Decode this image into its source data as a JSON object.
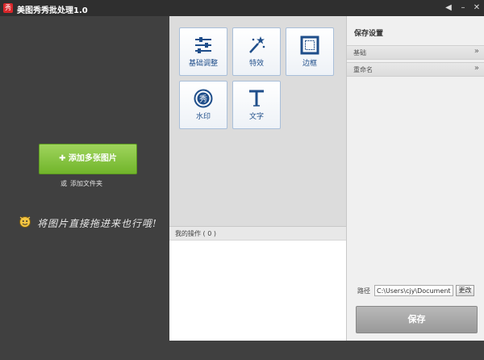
{
  "titlebar": {
    "app_icon_text": "秀",
    "title": "美图秀秀批处理1.0",
    "pin_icon": "◀",
    "min_icon": "–",
    "close_icon": "✕"
  },
  "left": {
    "add_button_label": "✚ 添加多张图片",
    "or_text": "或",
    "add_folder_link": "添加文件夹",
    "drag_hint": "将图片直接拖进来也行哦!"
  },
  "tools": [
    {
      "label": "基础调整",
      "icon": "sliders-icon"
    },
    {
      "label": "特效",
      "icon": "magic-wand-icon"
    },
    {
      "label": "边框",
      "icon": "frame-icon"
    },
    {
      "label": "水印",
      "icon": "watermark-icon"
    },
    {
      "label": "文字",
      "icon": "text-icon"
    }
  ],
  "operations": {
    "header_label": "我的操作 ( 0 )"
  },
  "save_settings": {
    "title": "保存设置",
    "sections": [
      {
        "label": "基础"
      },
      {
        "label": "重命名"
      }
    ],
    "path_label": "路径",
    "path_value": "C:\\Users\\cjy\\Documents",
    "change_button_label": "更改",
    "save_button_label": "保存"
  },
  "colors": {
    "accent_green": "#71b52b",
    "tile_text": "#1f4e8a",
    "dark_bg": "#404040"
  }
}
